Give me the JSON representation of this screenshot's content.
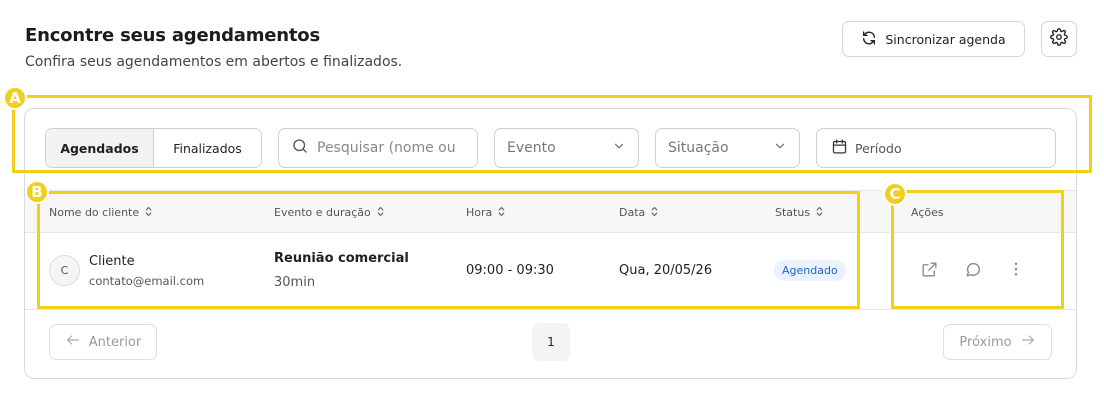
{
  "header": {
    "title": "Encontre seus agendamentos",
    "subtitle": "Confira seus agendamentos em abertos e finalizados.",
    "sync_label": "Sincronizar agenda"
  },
  "filters": {
    "tabs": [
      {
        "label": "Agendados",
        "active": true
      },
      {
        "label": "Finalizados",
        "active": false
      }
    ],
    "search_placeholder": "Pesquisar (nome ou",
    "event_select": "Evento",
    "status_select": "Situação",
    "period_label": "Período"
  },
  "table": {
    "columns": {
      "client": "Nome do cliente",
      "event": "Evento e duração",
      "hour": "Hora",
      "date": "Data",
      "status": "Status",
      "actions": "Ações"
    },
    "rows": [
      {
        "avatar_initial": "C",
        "client_name": "Cliente",
        "client_email": "contato@email.com",
        "event_name": "Reunião comercial",
        "duration": "30min",
        "hour": "09:00 - 09:30",
        "date": "Qua, 20/05/26",
        "status": "Agendado"
      }
    ],
    "row_actions": [
      "external-link-icon",
      "chat-icon",
      "more-vertical-icon"
    ]
  },
  "pagination": {
    "prev_label": "Anterior",
    "current_page": "1",
    "next_label": "Próximo"
  },
  "annotations": {
    "a": "A",
    "b": "B",
    "c": "C"
  },
  "colors": {
    "annotation": "#f2cf1e",
    "badge_bg": "#eaf2fd",
    "badge_text": "#2166c8"
  }
}
